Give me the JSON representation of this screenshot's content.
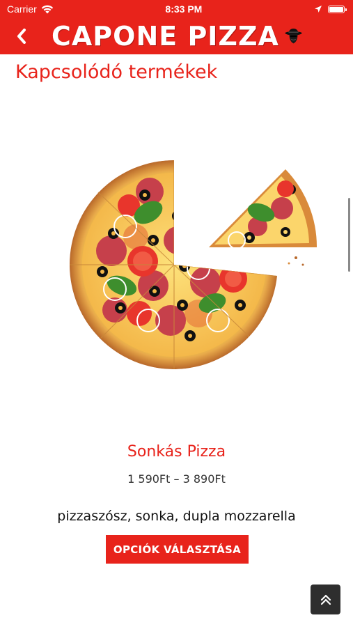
{
  "status_bar": {
    "carrier": "Carrier",
    "time": "8:33 PM"
  },
  "header": {
    "logo_text": "CAPONE PIZZA",
    "back_icon": "chevron-left-icon",
    "brand_color": "#e8231b"
  },
  "section": {
    "title": "Kapcsolódó termékek"
  },
  "product": {
    "name": "Sonkás Pizza",
    "price_range": "1 590Ft – 3 890Ft",
    "description": "pizzaszósz, sonka, dupla mozzarella",
    "button_label": "OPCIÓK VÁLASZTÁSA"
  },
  "scroll_to_top": {
    "icon": "double-chevron-up-icon"
  }
}
